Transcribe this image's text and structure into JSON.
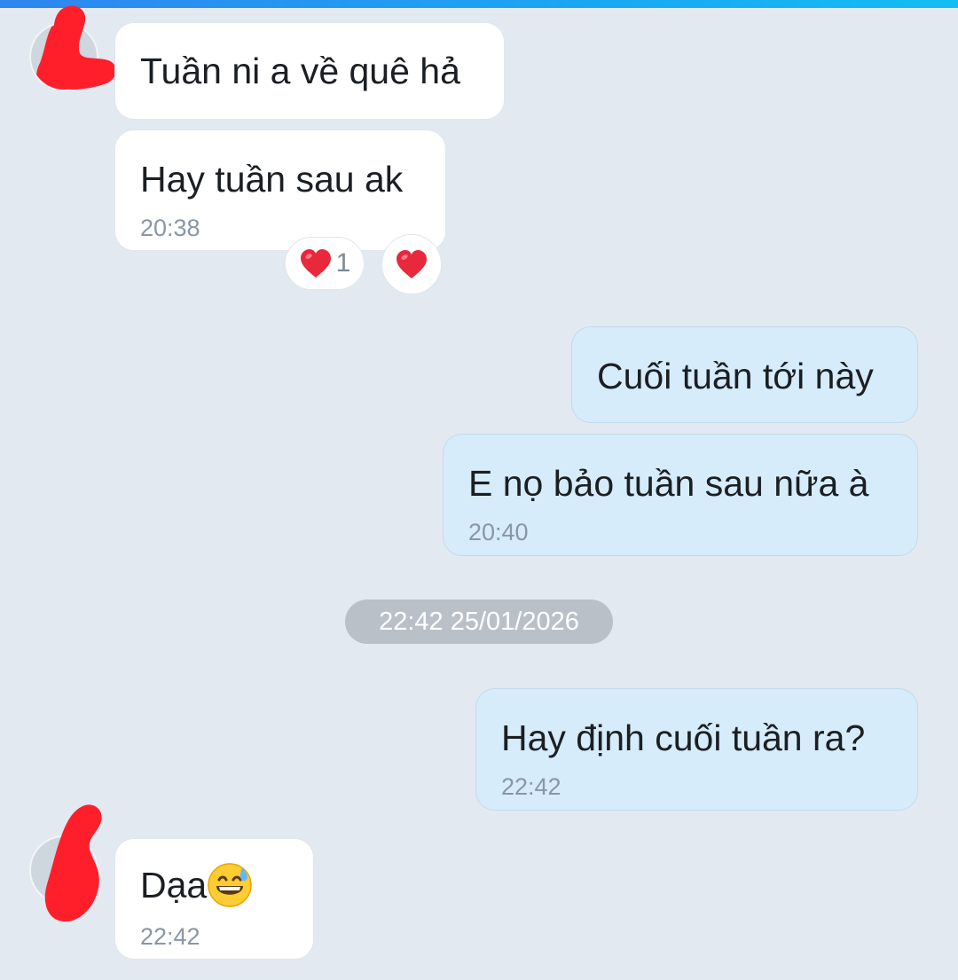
{
  "messages": [
    {
      "id": "m1",
      "direction": "incoming",
      "text": "Tuần ni a về quê hả",
      "time": ""
    },
    {
      "id": "m2",
      "direction": "incoming",
      "text": "Hay tuần sau ak",
      "time": "20:38"
    },
    {
      "id": "m3",
      "direction": "outgoing",
      "text": "Cuối tuần tới này",
      "time": ""
    },
    {
      "id": "m4",
      "direction": "outgoing",
      "text": "E nọ bảo tuần sau nữa à",
      "time": "20:40"
    },
    {
      "id": "m5",
      "direction": "outgoing",
      "text": "Hay định cuối tuần ra?",
      "time": "22:42"
    },
    {
      "id": "m6",
      "direction": "incoming",
      "text": "Dạa",
      "emoji": "grinning-sweat-emoji",
      "time": "22:42"
    }
  ],
  "reactions": {
    "summary": {
      "icon": "heart-icon",
      "count": "1"
    },
    "add": {
      "icon": "heart-icon"
    }
  },
  "date_separator": "22:42 25/01/2026",
  "colors": {
    "background": "#e2e9f1",
    "incoming_bubble": "#ffffff",
    "outgoing_bubble": "#d6ecfb",
    "timestamp": "#8a96a3",
    "heart": "#e8283b",
    "redaction": "#ff1f2a",
    "accent_bar": "#1aa6f2"
  }
}
